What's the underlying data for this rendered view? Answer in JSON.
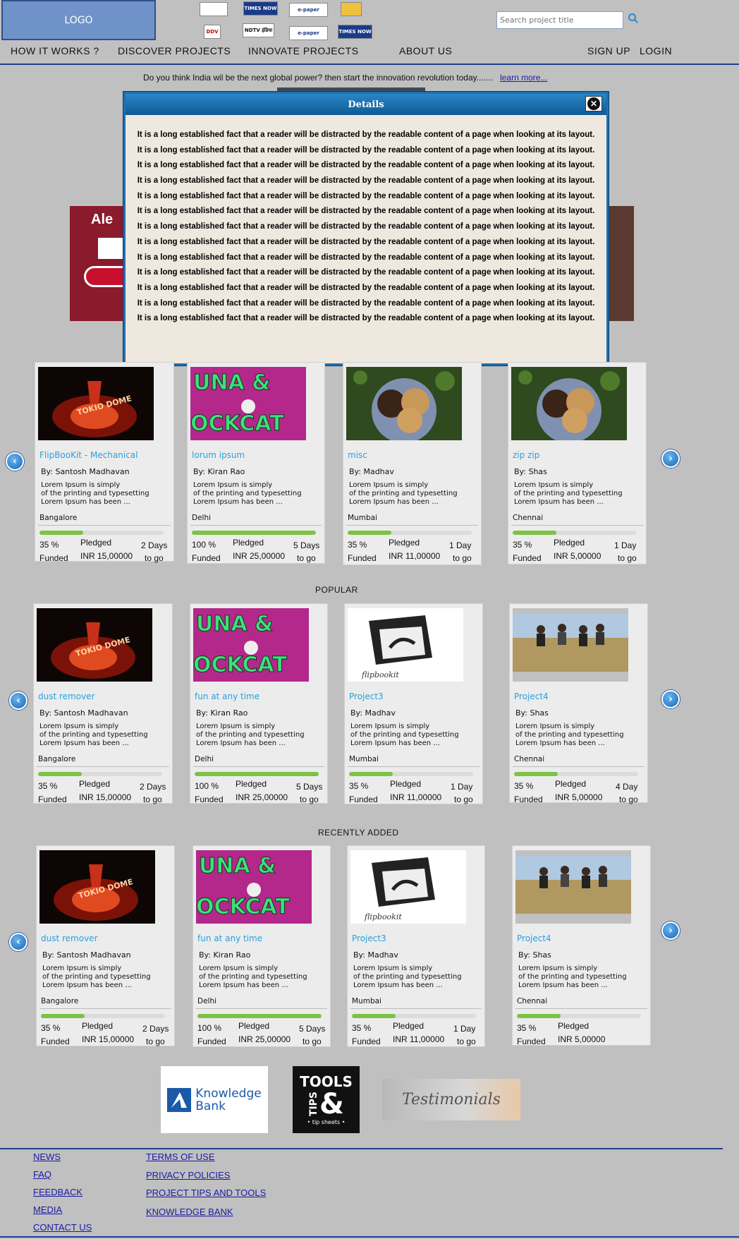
{
  "header": {
    "logo": "LOGO",
    "partners": [
      "",
      "TIMES NOW",
      "e-paper",
      "",
      "DDV",
      "NDTV इंडिया",
      "e-paper",
      "TIMES NOW"
    ],
    "search_placeholder": "Search project title"
  },
  "nav": {
    "how_it_works": "HOW IT WORKS ?",
    "discover": "DISCOVER PROJECTS",
    "innovate": "INNOVATE PROJECTS",
    "about": "ABOUT US",
    "signup": "SIGN UP",
    "login": "LOGIN"
  },
  "tagline": {
    "text": "Do you think India wil be the next global power? then start the innovation revolution today.......",
    "link": "learn more..."
  },
  "modal": {
    "title": "Details",
    "lines": [
      "It is a long established fact that a reader will be distracted by the readable content of a page when looking at its layout.",
      "It is a long established fact that a reader will be distracted by the readable content of a page when looking at its layout.",
      "It is a long established fact that a reader will be distracted by the readable content of a page when looking at its layout.",
      "It is a long established fact that a reader will be distracted by the readable content of a page when looking at its layout.",
      "It is a long established fact that a reader will be distracted by the readable content of a page when looking at its layout.",
      "It is a long established fact that a reader will be distracted by the readable content of a page when looking at its layout.",
      "It is a long established fact that a reader will be distracted by the readable content of a page when looking at its layout.",
      "It is a long established fact that a reader will be distracted by the readable content of a page when looking at its layout.",
      "It is a long established fact that a reader will be distracted by the readable content of a page when looking at its layout.",
      "It is a long established fact that a reader will be distracted by the readable content of a page when looking at its layout.",
      "It is a long established fact that a reader will be distracted by the readable content of a page when looking at its layout.",
      "It is a long established fact that a reader will be distracted by the readable content of a page when looking at its layout.",
      "It is a long established fact that a reader will be distracted by the readable content of a page when looking at its layout."
    ]
  },
  "sections": {
    "popular": "POPULAR",
    "recent": "RECENTLY ADDED"
  },
  "featured": [
    {
      "title": "FlipBooKit - Mechanical",
      "by": "By: Santosh Madhavan",
      "desc": [
        "Lorem Ipsum is simply",
        "of the printing and typesetting",
        "Lorem Ipsum has been ..."
      ],
      "city": "Bangalore",
      "pct": "35 %",
      "funded": "Funded",
      "pledged": "Pledged",
      "amount": "INR 15,00000",
      "days": "2 Days",
      "togo": "to go",
      "progress": 0.35,
      "thumb": "tokio"
    },
    {
      "title": "lorum ipsum",
      "by": "By: Kiran Rao",
      "desc": [
        "Lorem Ipsum is simply",
        "of the printing and typesetting",
        "Lorem Ipsum has been ..."
      ],
      "city": "Delhi",
      "pct": "100 %",
      "funded": "Funded",
      "pledged": "Pledged",
      "amount": "INR 25,00000",
      "days": "5 Days",
      "togo": "to go",
      "progress": 1.0,
      "thumb": "tuna"
    },
    {
      "title": "misc",
      "by": "By: Madhav",
      "desc": [
        "Lorem Ipsum is simply",
        "of the printing and typesetting",
        "Lorem Ipsum has been ..."
      ],
      "city": "Mumbai",
      "pct": "35 %",
      "funded": "Funded",
      "pledged": "Pledged",
      "amount": "INR 11,00000",
      "days": "1 Day",
      "togo": "to go",
      "progress": 0.35,
      "thumb": "cookies"
    },
    {
      "title": "zip zip",
      "by": "By: Shas",
      "desc": [
        "Lorem Ipsum is simply",
        "of the printing and typesetting",
        "Lorem Ipsum has been ..."
      ],
      "city": "Chennai",
      "pct": "35 %",
      "funded": "Funded",
      "pledged": "Pledged",
      "amount": "INR 5,00000",
      "days": "1 Day",
      "togo": "to go",
      "progress": 0.35,
      "thumb": "cookies"
    }
  ],
  "popular": [
    {
      "title": "dust remover",
      "by": "By: Santosh Madhavan",
      "desc": [
        "Lorem Ipsum is simply",
        "of the printing and typesetting",
        "Lorem Ipsum has been ..."
      ],
      "city": "Bangalore",
      "pct": "35 %",
      "funded": "Funded",
      "pledged": "Pledged",
      "amount": "INR 15,00000",
      "days": "2 Days",
      "togo": "to go",
      "progress": 0.35,
      "thumb": "tokio"
    },
    {
      "title": "fun at any time",
      "by": "By: Kiran Rao",
      "desc": [
        "Lorem Ipsum is simply",
        "of the printing and typesetting",
        "Lorem Ipsum has been ..."
      ],
      "city": "Delhi",
      "pct": "100 %",
      "funded": "Funded",
      "pledged": "Pledged",
      "amount": "INR 25,00000",
      "days": "5 Days",
      "togo": "to go",
      "progress": 1.0,
      "thumb": "tuna"
    },
    {
      "title": "Project3",
      "by": "By: Madhav",
      "desc": [
        "Lorem Ipsum is simply",
        "of the printing and typesetting",
        "Lorem Ipsum has been ..."
      ],
      "city": "Mumbai",
      "pct": "35 %",
      "funded": "Funded",
      "pledged": "Pledged",
      "amount": "INR 11,00000",
      "days": "1 Day",
      "togo": "to go",
      "progress": 0.35,
      "thumb": "flipbook"
    },
    {
      "title": "Project4",
      "by": "By: Shas",
      "desc": [
        "Lorem Ipsum is simply",
        "of the printing and typesetting",
        "Lorem Ipsum has been ..."
      ],
      "city": "Chennai",
      "pct": "35 %",
      "funded": "Funded",
      "pledged": "Pledged",
      "amount": "INR 5,00000",
      "days": "4 Day",
      "togo": "to go",
      "progress": 0.35,
      "thumb": "field"
    }
  ],
  "recent": [
    {
      "title": "dust remover",
      "by": "By: Santosh Madhavan",
      "desc": [
        "Lorem Ipsum is simply",
        "of the printing and typesetting",
        "Lorem Ipsum has been ..."
      ],
      "city": "Bangalore",
      "pct": "35 %",
      "funded": "Funded",
      "pledged": "Pledged",
      "amount": "INR 15,00000",
      "days": "2 Days",
      "togo": "to go",
      "progress": 0.35,
      "thumb": "tokio"
    },
    {
      "title": "fun at any time",
      "by": "By: Kiran Rao",
      "desc": [
        "Lorem Ipsum is simply",
        "of the printing and typesetting",
        "Lorem Ipsum has been ..."
      ],
      "city": "Delhi",
      "pct": "100 %",
      "funded": "Funded",
      "pledged": "Pledged",
      "amount": "INR 25,00000",
      "days": "5 Days",
      "togo": "to go",
      "progress": 1.0,
      "thumb": "tuna"
    },
    {
      "title": "Project3",
      "by": "By: Madhav",
      "desc": [
        "Lorem Ipsum is simply",
        "of the printing and typesetting",
        "Lorem Ipsum has been ..."
      ],
      "city": "Mumbai",
      "pct": "35 %",
      "funded": "Funded",
      "pledged": "Pledged",
      "amount": "INR 11,00000",
      "days": "1 Day",
      "togo": "to go",
      "progress": 0.35,
      "thumb": "flipbook"
    },
    {
      "title": "Project4",
      "by": "By: Shas",
      "desc": [
        "Lorem Ipsum is simply",
        "of the printing and typesetting",
        "Lorem Ipsum has been ..."
      ],
      "city": "Chennai",
      "pct": "35 %",
      "funded": "Funded",
      "pledged": "Pledged",
      "amount": "INR 5,00000",
      "days": "",
      "togo": "",
      "progress": 0.35,
      "thumb": "field"
    }
  ],
  "promos": {
    "knowledge_1": "Knowledge",
    "knowledge_2": "Bank",
    "tools_1": "TOOLS",
    "tools_amp": "&",
    "tools_2": "TIPS",
    "tools_3": "• tip sheets •",
    "testimonials": "Testimonials"
  },
  "footer": {
    "col1": [
      "NEWS",
      "FAQ",
      "FEEDBACK",
      "MEDIA",
      "CONTACT US"
    ],
    "col2": [
      "TERMS OF USE",
      "PRIVACY POLICIES",
      "PROJECT TIPS AND TOOLS",
      "KNOWLEDGE BANK"
    ]
  },
  "colors": {
    "accent": "#29a0dc",
    "progress": "#7cc243",
    "nav_line": "#1f3f8f",
    "link": "#1a1aa8"
  }
}
